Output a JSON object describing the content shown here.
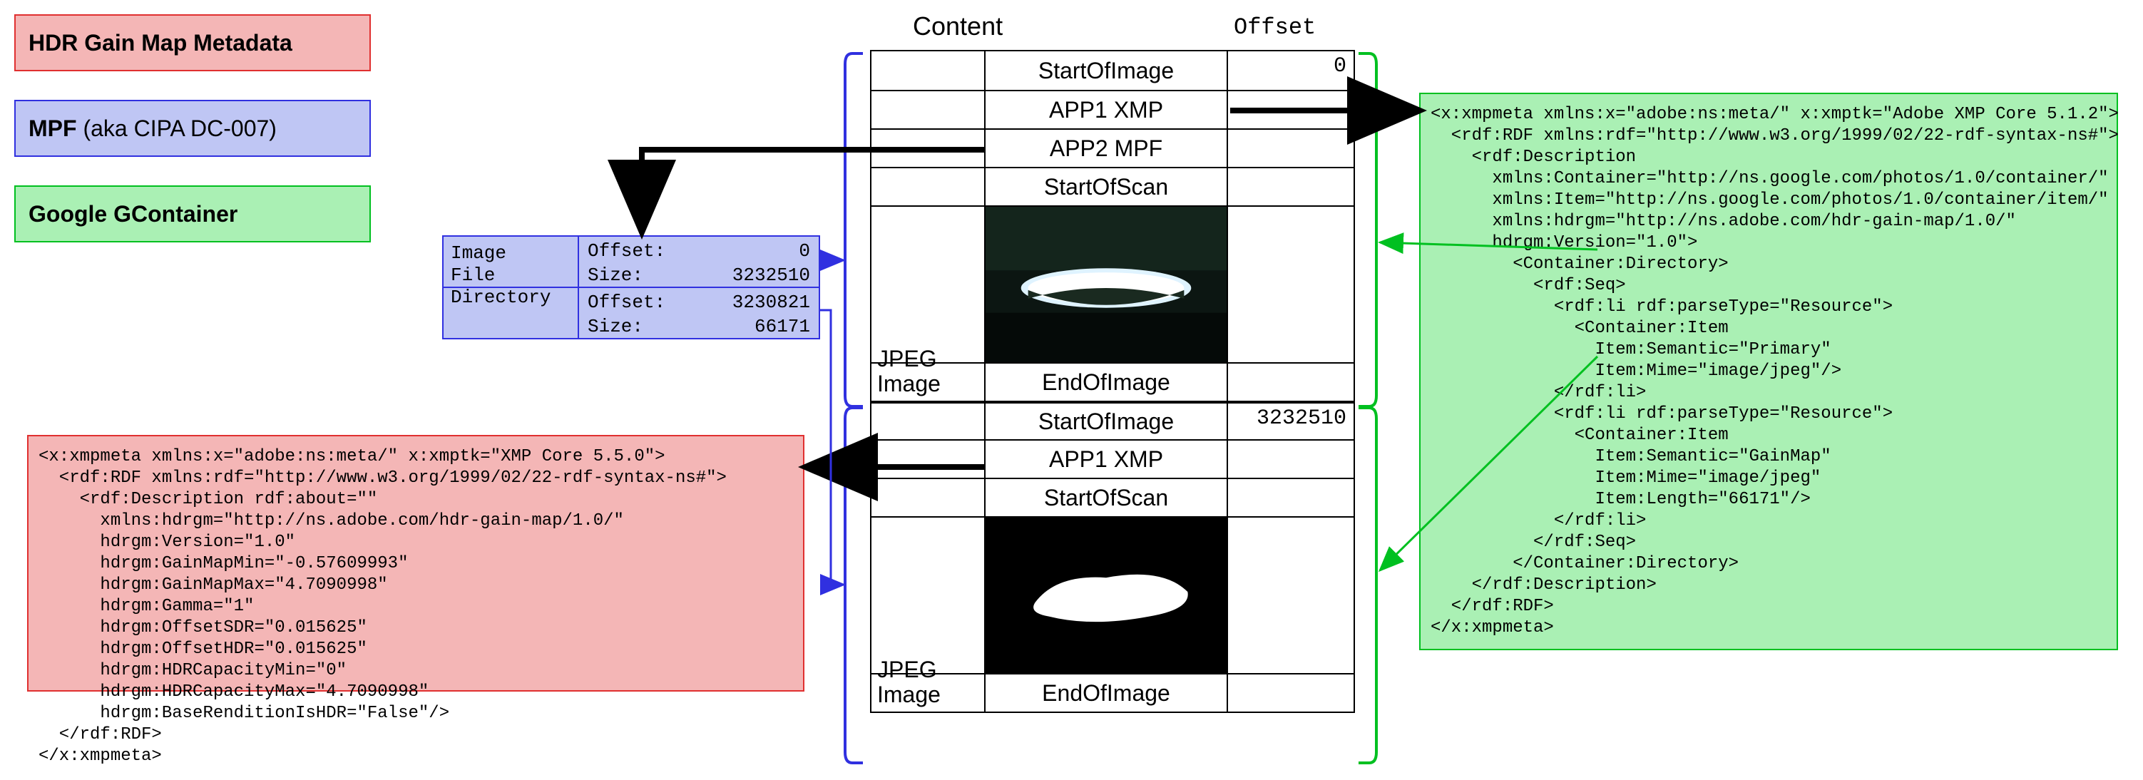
{
  "legend": {
    "red": "HDR Gain Map Metadata",
    "blue_bold": "MPF",
    "blue_rest": " (aka CIPA DC-007)",
    "green": "Google GContainer"
  },
  "headers": {
    "content": "Content",
    "offset": "Offset"
  },
  "blocks": {
    "jpeg1": {
      "label": "JPEG\nImage",
      "rows": [
        "StartOfImage",
        "APP1 XMP",
        "APP2 MPF",
        "StartOfScan",
        "",
        "EndOfImage"
      ],
      "offset": "0"
    },
    "jpeg2": {
      "label": "JPEG\nImage",
      "rows": [
        "StartOfImage",
        "APP1 XMP",
        "StartOfScan",
        "",
        "EndOfImage"
      ],
      "offset": "3232510"
    }
  },
  "ifd": {
    "title": "Image\nFile\nDirectory",
    "entries": [
      {
        "offset_label": "Offset:",
        "offset": "0",
        "size_label": "Size:",
        "size": "3232510"
      },
      {
        "offset_label": "Offset:",
        "offset": "3230821",
        "size_label": "Size:",
        "size": "66171"
      }
    ]
  },
  "xmp_green": "<x:xmpmeta xmlns:x=\"adobe:ns:meta/\" x:xmptk=\"Adobe XMP Core 5.1.2\">\n  <rdf:RDF xmlns:rdf=\"http://www.w3.org/1999/02/22-rdf-syntax-ns#\">\n    <rdf:Description\n      xmlns:Container=\"http://ns.google.com/photos/1.0/container/\"\n      xmlns:Item=\"http://ns.google.com/photos/1.0/container/item/\"\n      xmlns:hdrgm=\"http://ns.adobe.com/hdr-gain-map/1.0/\"\n      hdrgm:Version=\"1.0\">\n        <Container:Directory>\n          <rdf:Seq>\n            <rdf:li rdf:parseType=\"Resource\">\n              <Container:Item\n                Item:Semantic=\"Primary\"\n                Item:Mime=\"image/jpeg\"/>\n            </rdf:li>\n            <rdf:li rdf:parseType=\"Resource\">\n              <Container:Item\n                Item:Semantic=\"GainMap\"\n                Item:Mime=\"image/jpeg\"\n                Item:Length=\"66171\"/>\n            </rdf:li>\n          </rdf:Seq>\n        </Container:Directory>\n    </rdf:Description>\n  </rdf:RDF>\n</x:xmpmeta>",
  "xmp_red": "<x:xmpmeta xmlns:x=\"adobe:ns:meta/\" x:xmptk=\"XMP Core 5.5.0\">\n  <rdf:RDF xmlns:rdf=\"http://www.w3.org/1999/02/22-rdf-syntax-ns#\">\n    <rdf:Description rdf:about=\"\"\n      xmlns:hdrgm=\"http://ns.adobe.com/hdr-gain-map/1.0/\"\n      hdrgm:Version=\"1.0\"\n      hdrgm:GainMapMin=\"-0.57609993\"\n      hdrgm:GainMapMax=\"4.7090998\"\n      hdrgm:Gamma=\"1\"\n      hdrgm:OffsetSDR=\"0.015625\"\n      hdrgm:OffsetHDR=\"0.015625\"\n      hdrgm:HDRCapacityMin=\"0\"\n      hdrgm:HDRCapacityMax=\"4.7090998\"\n      hdrgm:BaseRenditionIsHDR=\"False\"/>\n  </rdf:RDF>\n</x:xmpmeta>"
}
